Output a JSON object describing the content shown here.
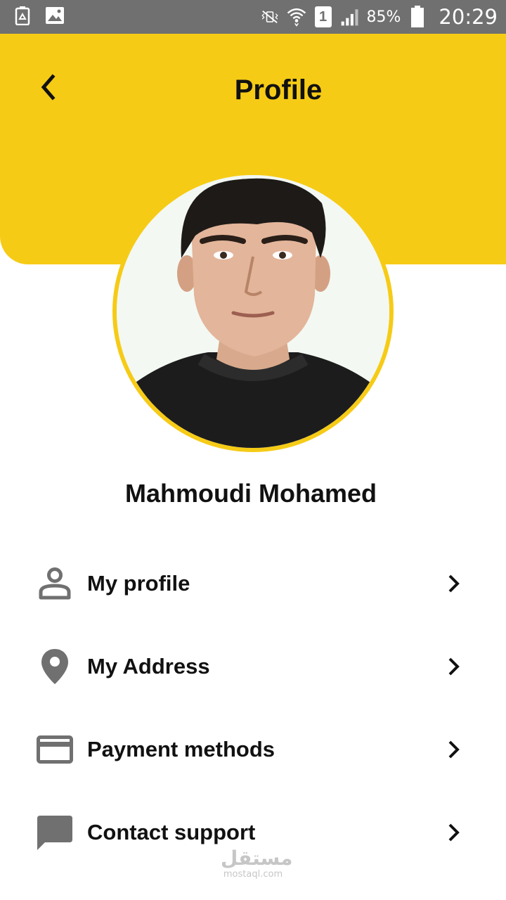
{
  "status_bar": {
    "battery_percent": "85%",
    "time": "20:29",
    "sim_slot": "1",
    "icons": [
      "recycle-icon",
      "image-icon",
      "vibrate-icon",
      "wifi-icon",
      "sim-icon",
      "signal-icon",
      "battery-icon"
    ]
  },
  "header": {
    "title": "Profile",
    "back_icon": "chevron-left-icon",
    "background_color": "#F6CB16"
  },
  "user": {
    "name": "Mahmoudi Mohamed",
    "avatar": "profile-photo"
  },
  "menu": {
    "items": [
      {
        "label": "My profile",
        "icon": "person-icon"
      },
      {
        "label": "My Address",
        "icon": "location-pin-icon"
      },
      {
        "label": "Payment methods",
        "icon": "credit-card-icon"
      },
      {
        "label": "Contact support",
        "icon": "chat-bubble-icon"
      }
    ]
  },
  "watermark": {
    "arabic": "مستقل",
    "latin": "mostaql.com"
  },
  "colors": {
    "accent": "#F6CB16",
    "status_bar": "#707070",
    "icon_gray": "#707070",
    "text": "#111111"
  }
}
